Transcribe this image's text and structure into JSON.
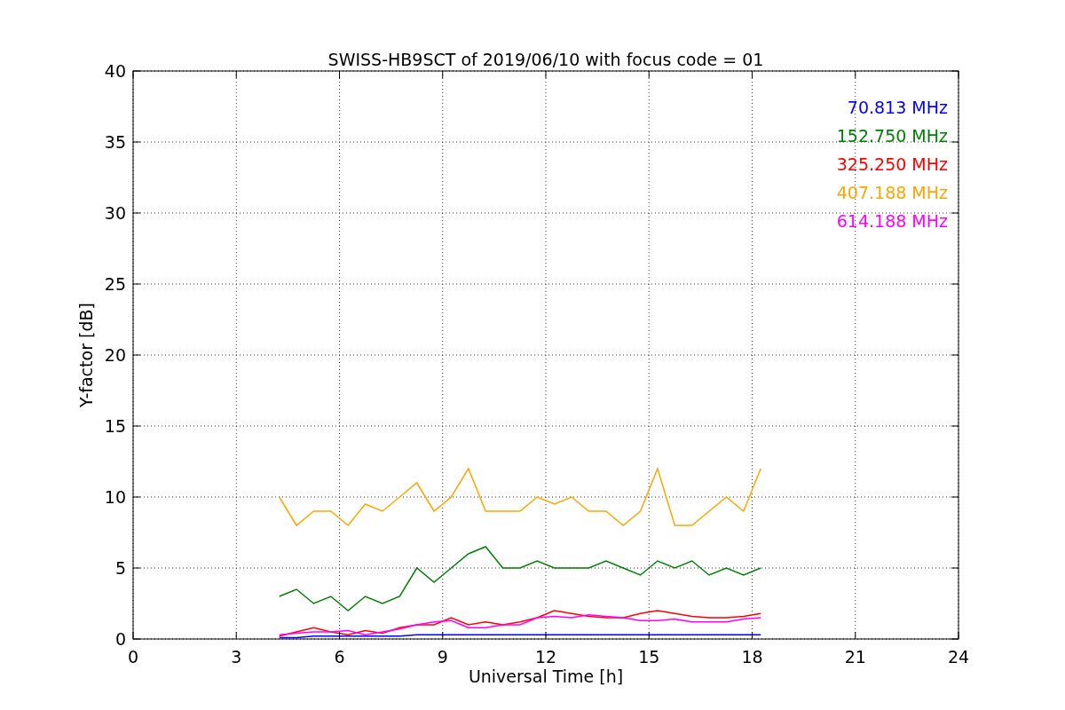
{
  "chart_data": {
    "type": "line",
    "title": "SWISS-HB9SCT of 2019/06/10 with focus code = 01",
    "xlabel": "Universal Time [h]",
    "ylabel": "Y-factor [dB]",
    "x": [
      4.25,
      4.75,
      5.25,
      5.75,
      6.25,
      6.75,
      7.25,
      7.75,
      8.25,
      8.75,
      9.25,
      9.75,
      10.25,
      10.75,
      11.25,
      11.75,
      12.25,
      12.75,
      13.25,
      13.75,
      14.25,
      14.75,
      15.25,
      15.75,
      16.25,
      16.75,
      17.25,
      17.75,
      18.25
    ],
    "series": [
      {
        "name": "70.813 MHz",
        "color": "#0000ff",
        "values": [
          0.1,
          0.1,
          0.2,
          0.2,
          0.2,
          0.2,
          0.2,
          0.2,
          0.3,
          0.3,
          0.3,
          0.3,
          0.3,
          0.3,
          0.3,
          0.3,
          0.3,
          0.3,
          0.3,
          0.3,
          0.3,
          0.3,
          0.3,
          0.3,
          0.3,
          0.3,
          0.3,
          0.3,
          0.3
        ]
      },
      {
        "name": "152.750 MHz",
        "color": "#008000",
        "values": [
          3,
          3.5,
          2.5,
          3,
          2,
          3,
          2.5,
          3,
          5,
          4,
          5,
          6,
          6.5,
          5,
          5,
          5.5,
          5,
          5,
          5,
          5.5,
          5,
          4.5,
          5.5,
          5,
          5.5,
          4.5,
          5,
          4.5,
          5
        ]
      },
      {
        "name": "325.250 MHz",
        "color": "#ff0000",
        "values": [
          0.2,
          0.5,
          0.8,
          0.5,
          0.3,
          0.6,
          0.4,
          0.8,
          1,
          1,
          1.5,
          1,
          1.2,
          1,
          1.2,
          1.5,
          2,
          1.8,
          1.6,
          1.5,
          1.5,
          1.8,
          2,
          1.8,
          1.6,
          1.5,
          1.5,
          1.6,
          1.8
        ]
      },
      {
        "name": "407.188 MHz",
        "color": "#ffa500",
        "values": [
          10,
          8,
          9,
          9,
          8,
          9.5,
          9,
          10,
          11,
          9,
          10,
          12,
          9,
          9,
          9,
          10,
          9.5,
          10,
          9,
          9,
          8,
          9,
          12,
          8,
          8,
          9,
          10,
          9,
          12
        ]
      },
      {
        "name": "614.188 MHz",
        "color": "#ff00ff",
        "values": [
          0.3,
          0.4,
          0.5,
          0.5,
          0.6,
          0.3,
          0.5,
          0.7,
          1,
          1.2,
          1.3,
          0.8,
          0.8,
          1,
          1,
          1.5,
          1.6,
          1.5,
          1.7,
          1.6,
          1.5,
          1.3,
          1.3,
          1.4,
          1.2,
          1.2,
          1.2,
          1.4,
          1.5
        ]
      }
    ],
    "grid": true,
    "xlim": [
      0,
      24
    ],
    "ylim": [
      0,
      40
    ],
    "xticks": [
      0,
      3,
      6,
      9,
      12,
      15,
      18,
      21,
      24
    ],
    "yticks": [
      0,
      5,
      10,
      15,
      20,
      25,
      30,
      35,
      40
    ]
  }
}
